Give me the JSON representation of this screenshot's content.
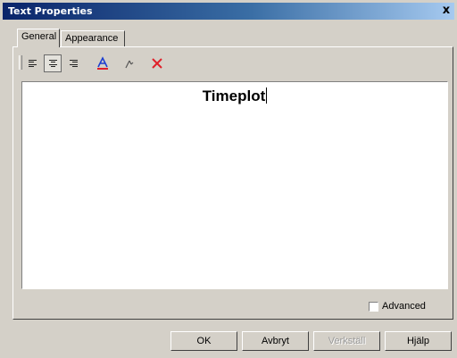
{
  "window": {
    "title": "Text Properties",
    "close_glyph": "x"
  },
  "tabs": [
    {
      "label": "General",
      "selected": true
    },
    {
      "label": "Appearance",
      "selected": false
    }
  ],
  "toolbar": {
    "buttons": [
      {
        "icon": "align-left-icon",
        "active": false
      },
      {
        "icon": "align-center-icon",
        "active": true
      },
      {
        "icon": "align-right-icon",
        "active": false
      },
      {
        "icon": "font-color-icon",
        "active": false,
        "color": "#1c3fd0",
        "underline_color": "#e0202a"
      },
      {
        "icon": "formula-icon",
        "active": false
      },
      {
        "icon": "delete-icon",
        "active": false,
        "color": "#e0202a"
      }
    ]
  },
  "editor": {
    "text": "Timeplot"
  },
  "advanced": {
    "label": "Advanced",
    "checked": false
  },
  "buttons": {
    "ok": "OK",
    "cancel": "Avbryt",
    "apply": "Verkställ",
    "help": "Hjälp"
  },
  "colors": {
    "title_bar": "#0a246a",
    "dialog_bg": "#d4d0c8"
  }
}
